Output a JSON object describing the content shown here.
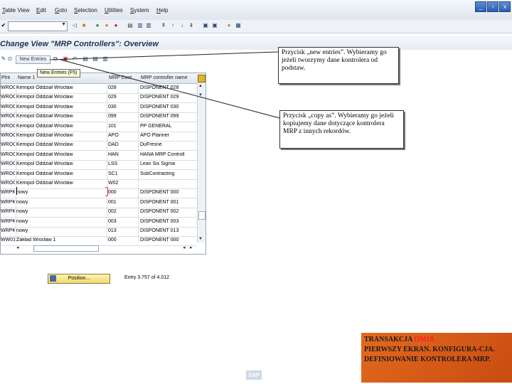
{
  "menu": [
    {
      "label": "Table View",
      "mnemonic_index": 0
    },
    {
      "label": "Edit",
      "mnemonic_index": 0
    },
    {
      "label": "Goto",
      "mnemonic_index": 0
    },
    {
      "label": "Selection",
      "mnemonic_index": 0
    },
    {
      "label": "Utilities",
      "mnemonic_index": 0
    },
    {
      "label": "System",
      "mnemonic_index": 0
    },
    {
      "label": "Help",
      "mnemonic_index": 0
    }
  ],
  "window_buttons": [
    "minimize-icon",
    "restore-icon",
    "close-icon"
  ],
  "command_field": {
    "value": ""
  },
  "title": "Change View \"MRP Controllers\": Overview",
  "app_toolbar": {
    "new_entries_label": "New Entries",
    "tooltip": "New Entries   (F5)"
  },
  "table": {
    "columns": [
      "Plnt",
      "Name 1",
      "MRP Cont",
      "MRP controller name"
    ],
    "rows": [
      {
        "plnt": "WROC",
        "name": "Kemipol Oddział Wrocław",
        "cont": "028",
        "ctrl": "DISPONENT 028"
      },
      {
        "plnt": "WROC",
        "name": "Kemipol Oddział Wrocław",
        "cont": "029",
        "ctrl": "DISPONENT 029"
      },
      {
        "plnt": "WROC",
        "name": "Kemipol Oddział Wrocław",
        "cont": "030",
        "ctrl": "DISPONENT 030"
      },
      {
        "plnt": "WROC",
        "name": "Kemipol Oddział Wrocław",
        "cont": "099",
        "ctrl": "DISPONENT 099"
      },
      {
        "plnt": "WROC",
        "name": "Kemipol Oddział Wrocław",
        "cont": "101",
        "ctrl": "PP GENERAL"
      },
      {
        "plnt": "WROC",
        "name": "Kemipol Oddział Wrocław",
        "cont": "APO",
        "ctrl": "APO Planner"
      },
      {
        "plnt": "WROC",
        "name": "Kemipol Oddział Wrocław",
        "cont": "DAD",
        "ctrl": "DuFresne"
      },
      {
        "plnt": "WROC",
        "name": "Kemipol Oddział Wrocław",
        "cont": "HAN",
        "ctrl": "HANA MRP Controll"
      },
      {
        "plnt": "WROC",
        "name": "Kemipol Oddział Wrocław",
        "cont": "LSS",
        "ctrl": "Lean Six Sigma"
      },
      {
        "plnt": "WROC",
        "name": "Kemipol Oddział Wrocław",
        "cont": "SC1",
        "ctrl": "SubContracting"
      },
      {
        "plnt": "WROC",
        "name": "Kemipol Oddział Wrocław",
        "cont": "W02",
        "ctrl": ""
      },
      {
        "plnt": "WRPK",
        "name": "nowy",
        "cont": "000",
        "ctrl": "DISPONENT 000"
      },
      {
        "plnt": "WRPK",
        "name": "nowy",
        "cont": "001",
        "ctrl": "DISPONENT 001"
      },
      {
        "plnt": "WRPK",
        "name": "nowy",
        "cont": "002",
        "ctrl": "DISPONENT 002"
      },
      {
        "plnt": "WRPK",
        "name": "nowy",
        "cont": "003",
        "ctrl": "DISPONENT 003"
      },
      {
        "plnt": "WRPK",
        "name": "nowy",
        "cont": "013",
        "ctrl": "DISPONENT 013"
      },
      {
        "plnt": "WW01",
        "name": "Zakład Wrocław 1",
        "cont": "000",
        "ctrl": "DISPONENT 000"
      }
    ]
  },
  "position_button": "Position...",
  "entry_info": "Entry 3.757 of 4.012",
  "callouts": {
    "new_entries": "Przycisk „new entries”. Wybieramy go jeżeli tworzymy dane kontrolera od podstaw.",
    "copy_as": "Przycisk „copy as”. Wybieramy go jeżeli kopiujemy dane dotyczące kontrolera MRP z innych rekordów."
  },
  "info_box": {
    "line1_prefix": "TRANSAKCJA ",
    "line1_highlight": "OM10.",
    "rest": "PIERWSZY EKRAN. KONFIGURA-CJA. DEFINIOWANIE KONTROLERA MRP."
  },
  "colors": {
    "info_box_bg": "#d85a18",
    "highlight": "#ff1e1e",
    "title_text": "#1f2f55"
  }
}
